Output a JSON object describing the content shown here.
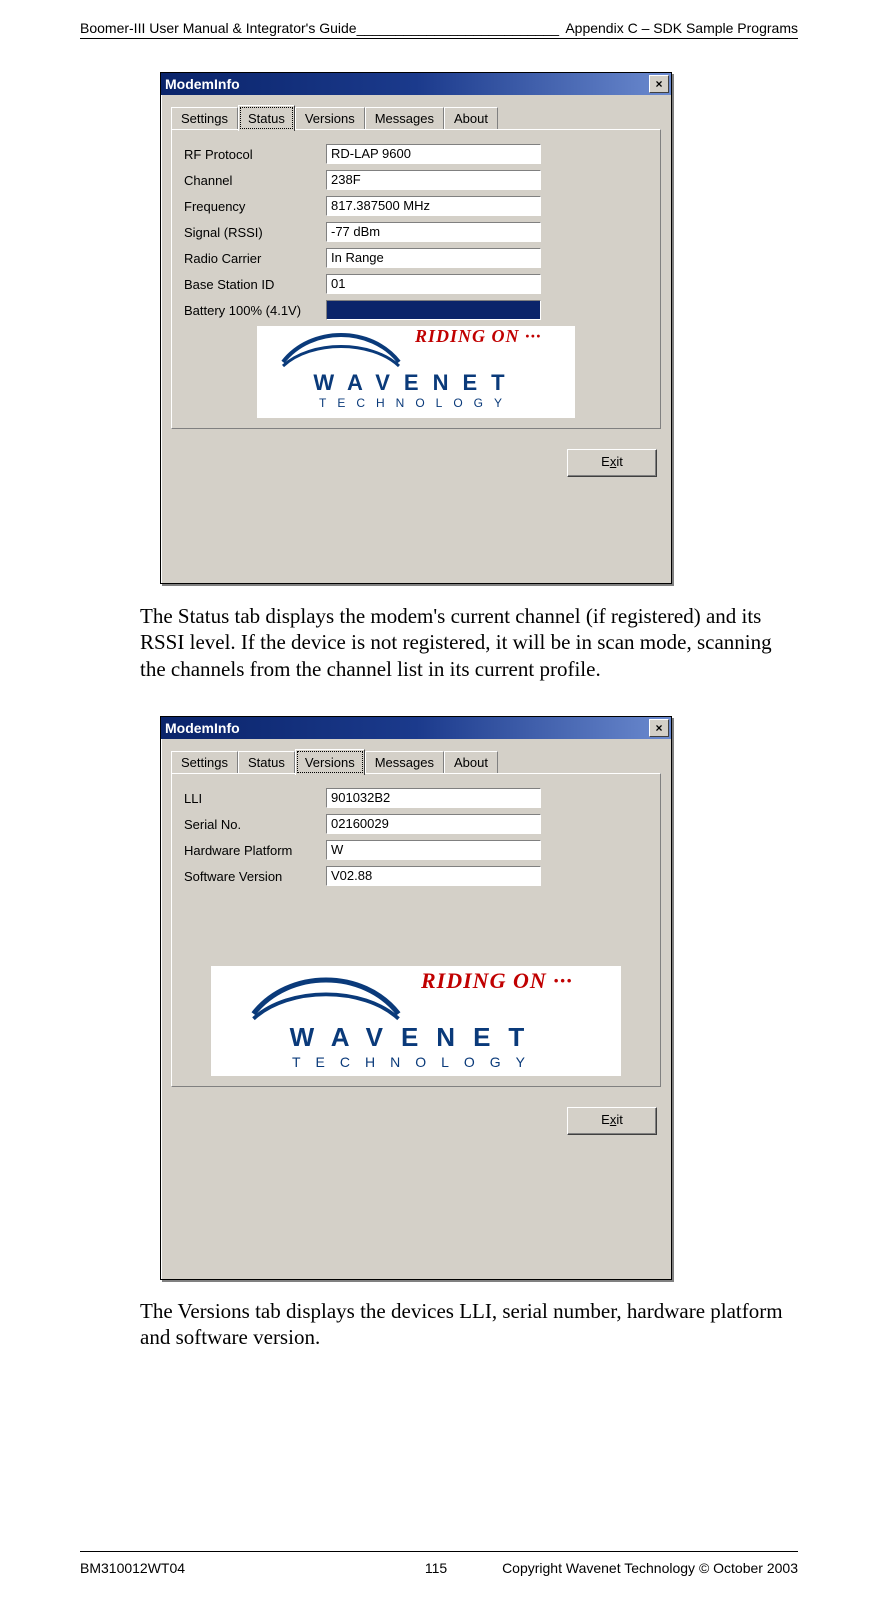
{
  "header": {
    "left": "Boomer-III User Manual & Integrator's Guide__________________________",
    "right": "Appendix C – SDK Sample Programs"
  },
  "footer": {
    "left": "BM310012WT04",
    "center": "115",
    "right": "Copyright Wavenet Technology © October 2003"
  },
  "dialog1": {
    "title": "ModemInfo",
    "close_label": "×",
    "tabs": [
      "Settings",
      "Status",
      "Versions",
      "Messages",
      "About"
    ],
    "active_tab_index": 1,
    "rows": [
      {
        "label": "RF Protocol",
        "value": "RD-LAP 9600"
      },
      {
        "label": "Channel",
        "value": "238F"
      },
      {
        "label": "Frequency",
        "value": "817.387500 MHz"
      },
      {
        "label": "Signal (RSSI)",
        "value": "-77 dBm"
      },
      {
        "label": "Radio Carrier",
        "value": "In Range"
      },
      {
        "label": "Base Station ID",
        "value": "01"
      },
      {
        "label": "Battery 100% (4.1V)",
        "value": ""
      }
    ],
    "selected_row_index": 6,
    "logo": {
      "riding": "RIDING ON ···",
      "wavenet": "WAVENET",
      "technology": "TECHNOLOGY"
    },
    "exit_letter": "x",
    "exit_rest": "it",
    "exit_prefix": "E"
  },
  "paragraph1": "The Status tab displays the modem's current channel (if registered) and its RSSI level. If the device is not registered, it will be in scan mode, scanning the channels from the channel list in its current profile.",
  "dialog2": {
    "title": "ModemInfo",
    "close_label": "×",
    "tabs": [
      "Settings",
      "Status",
      "Versions",
      "Messages",
      "About"
    ],
    "active_tab_index": 2,
    "rows": [
      {
        "label": "LLI",
        "value": "901032B2"
      },
      {
        "label": "Serial No.",
        "value": "02160029"
      },
      {
        "label": "Hardware Platform",
        "value": "W"
      },
      {
        "label": "Software Version",
        "value": "V02.88"
      }
    ],
    "logo": {
      "riding": "RIDING ON ···",
      "wavenet": "WAVENET",
      "technology": "TECHNOLOGY"
    },
    "exit_letter": "x",
    "exit_rest": "it",
    "exit_prefix": "E"
  },
  "paragraph2": "The Versions tab displays the devices LLI, serial number, hardware platform and software version."
}
